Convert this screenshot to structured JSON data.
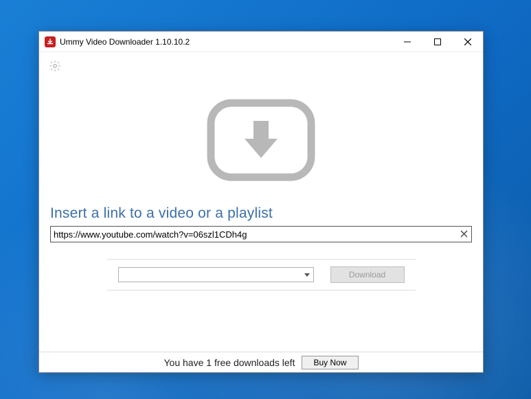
{
  "window": {
    "title": "Ummy Video Downloader 1.10.10.2"
  },
  "main": {
    "prompt": "Insert a link to a video or a playlist",
    "url_value": "https://www.youtube.com/watch?v=06szl1CDh4g"
  },
  "actions": {
    "download_label": "Download",
    "buy_label": "Buy Now"
  },
  "footer": {
    "status": "You have 1 free downloads left"
  }
}
